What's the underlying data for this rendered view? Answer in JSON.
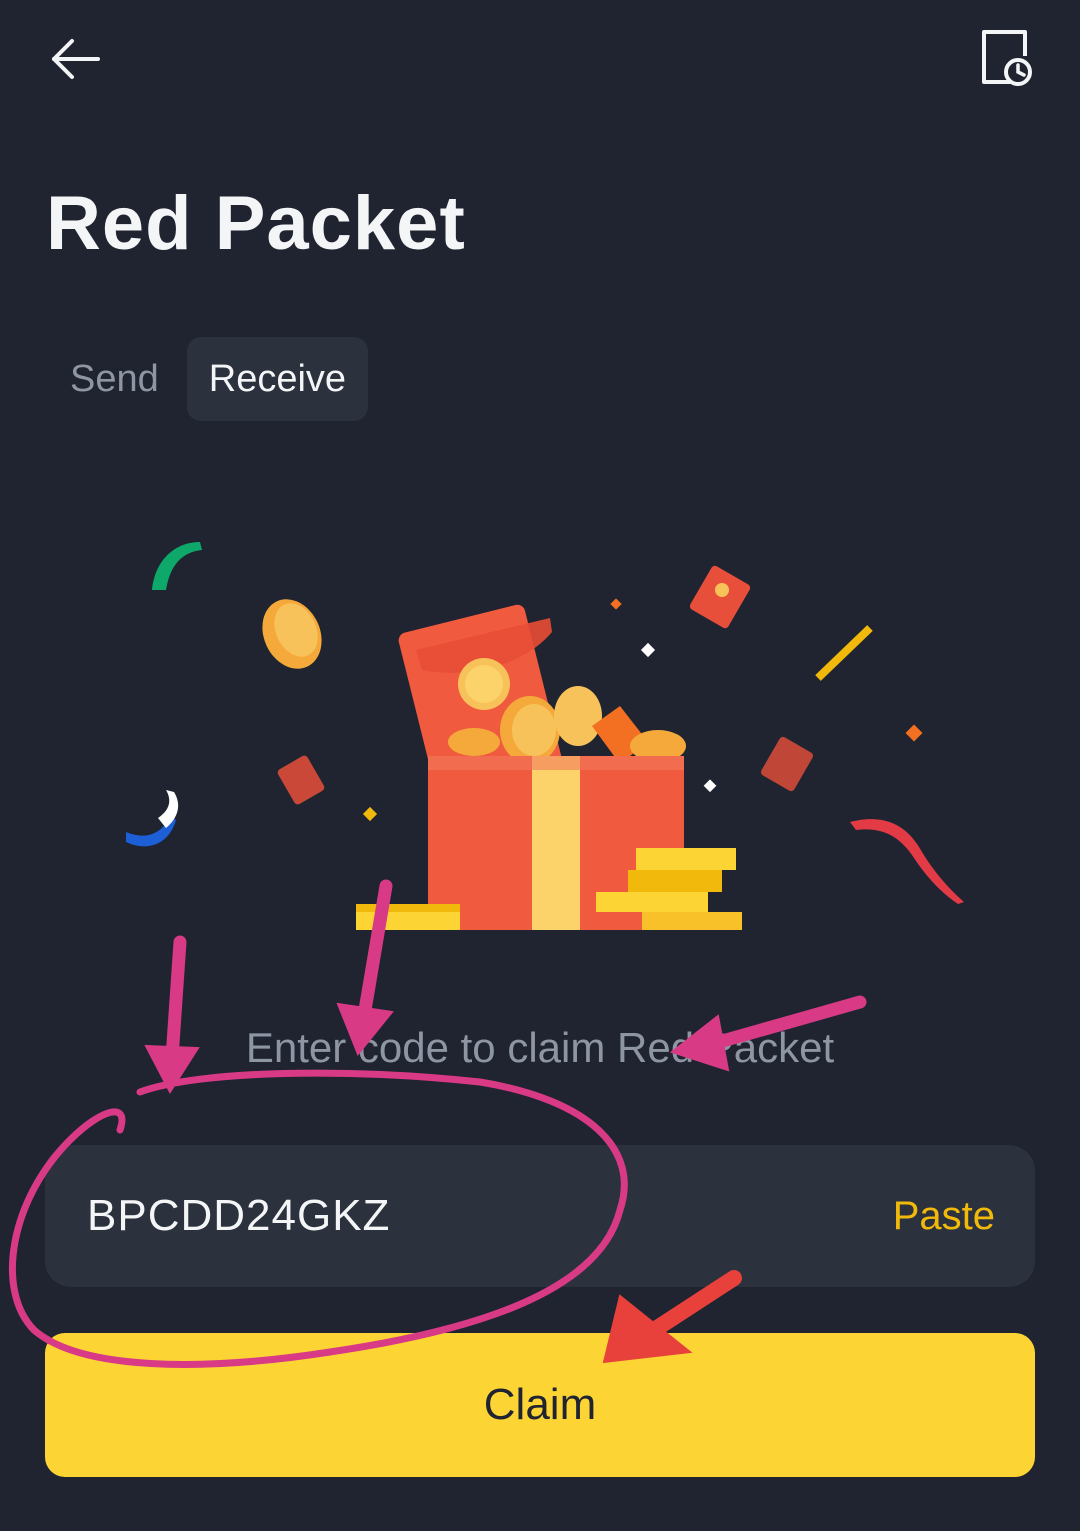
{
  "header": {
    "back_icon": "arrow-left-icon",
    "history_icon": "document-clock-icon"
  },
  "page": {
    "title": "Red Packet"
  },
  "tabs": [
    {
      "label": "Send",
      "active": false
    },
    {
      "label": "Receive",
      "active": true
    }
  ],
  "receive": {
    "prompt": "Enter code to claim Red Packet",
    "code_value": "BPCDD24GKZ",
    "paste_label": "Paste",
    "claim_label": "Claim"
  },
  "colors": {
    "background": "#1f2430",
    "field_bg": "#2b313d",
    "accent_yellow": "#fcd535",
    "paste_text": "#f0b90b",
    "muted_text": "#8f96a3",
    "annotation_pink": "#d93a86",
    "annotation_red": "#e8413c"
  }
}
